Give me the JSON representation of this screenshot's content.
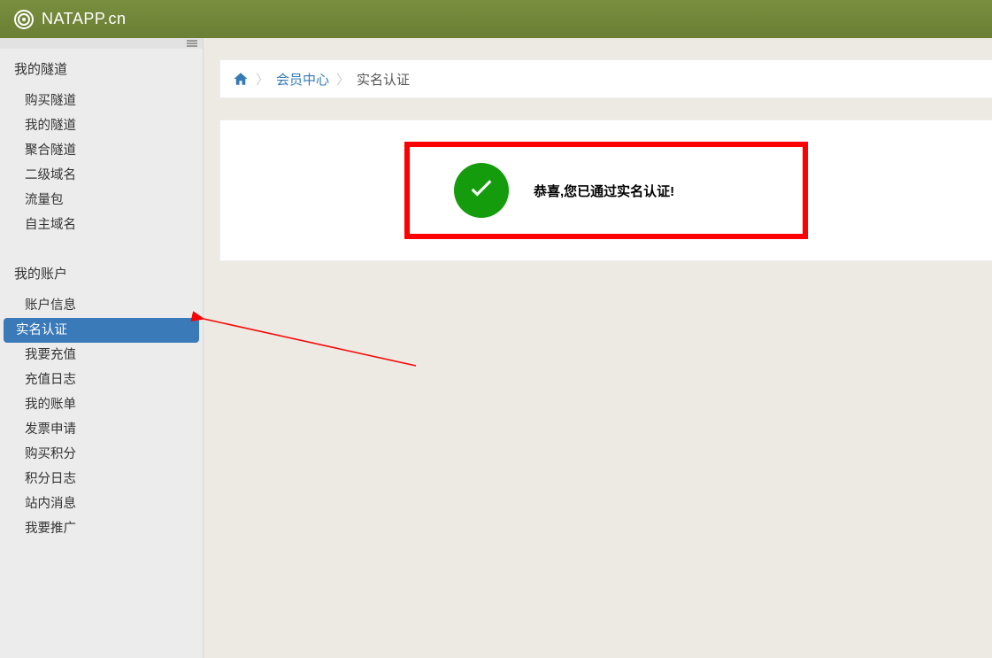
{
  "brand": "NATAPP.cn",
  "breadcrumb": {
    "member_center": "会员中心",
    "current": "实名认证"
  },
  "result": {
    "message": "恭喜,您已通过实名认证!"
  },
  "sidebar": {
    "section1_title": "我的隧道",
    "section1_items": [
      "购买隧道",
      "我的隧道",
      "聚合隧道",
      "二级域名",
      "流量包",
      "自主域名"
    ],
    "section2_title": "我的账户",
    "section2_items": [
      "账户信息",
      "实名认证",
      "我要充值",
      "充值日志",
      "我的账单",
      "发票申请",
      "购买积分",
      "积分日志",
      "站内消息",
      "我要推广"
    ],
    "active_item": "实名认证"
  },
  "colors": {
    "accent": "#3a7ab8",
    "success": "#159c0d",
    "highlight": "#ff0000"
  }
}
